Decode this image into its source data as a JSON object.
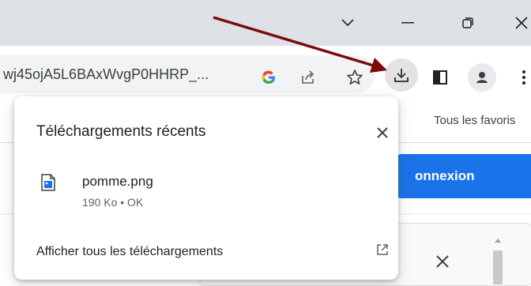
{
  "titlebar": {
    "tab_dropdown_icon": "chevron-down-icon",
    "minimize_icon": "minimize-icon",
    "restore_icon": "restore-icon",
    "close_icon": "close-icon"
  },
  "toolbar": {
    "url": "wj45ojA5L6BAxWvgP0HHRP_...",
    "google_icon": "google-icon",
    "share_icon": "share-icon",
    "star_icon": "star-icon",
    "download_icon": "download-icon",
    "side_panel_icon": "side-panel-icon",
    "profile_icon": "profile-icon",
    "menu_icon": "kebab-menu-icon"
  },
  "bookmarks": {
    "all_bookmarks": "Tous les favoris"
  },
  "page": {
    "connexion_label": "onnexion"
  },
  "downloads_popup": {
    "title": "Téléchargements récents",
    "items": [
      {
        "name": "pomme.png",
        "status": "190 Ko • OK",
        "icon": "image-file-icon"
      }
    ],
    "show_all_label": "Afficher tous les téléchargements",
    "external_icon": "open-external-icon"
  },
  "annotation": {
    "color": "#7b0c0c"
  }
}
